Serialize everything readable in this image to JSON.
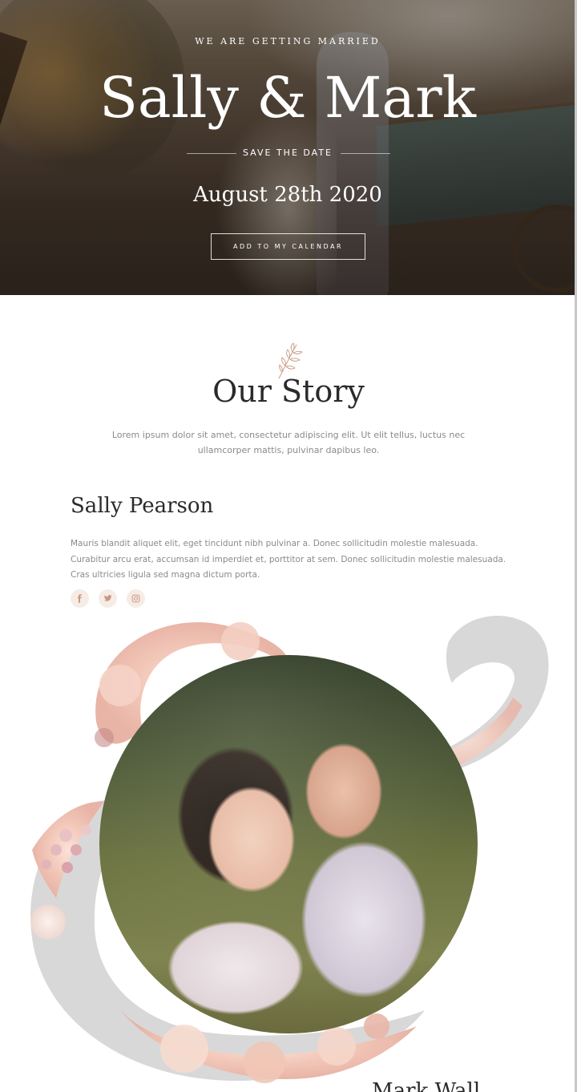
{
  "hero": {
    "kicker": "WE ARE GETTING MARRIED",
    "names": "Sally & Mark",
    "save_the_date": "SAVE THE DATE",
    "date": "August 28th 2020",
    "calendar_button": "ADD TO MY CALENDAR"
  },
  "story": {
    "title": "Our Story",
    "intro": "Lorem ipsum dolor sit amet, consectetur adipiscing elit. Ut elit tellus, luctus nec ullamcorper mattis, pulvinar dapibus leo."
  },
  "bride": {
    "name": "Sally Pearson",
    "bio": "Mauris blandit aliquet elit, eget tincidunt nibh pulvinar a. Donec sollicitudin molestie malesuada. Curabitur arcu erat, accumsan id imperdiet et, porttitor at sem. Donec sollicitudin molestie malesuada. Cras ultricies ligula sed magna dictum porta.",
    "socials": [
      "facebook-icon",
      "twitter-icon",
      "instagram-icon"
    ]
  },
  "groom": {
    "name_partial": "Mark Wall"
  },
  "colors": {
    "accent": "#c9977d",
    "social_bg": "#f6ece6",
    "text_muted": "#8a8a8a",
    "heading": "#2a2a2a",
    "ampersand_gray": "#d8d8d8",
    "flower_pink": "#f2c8bc"
  }
}
